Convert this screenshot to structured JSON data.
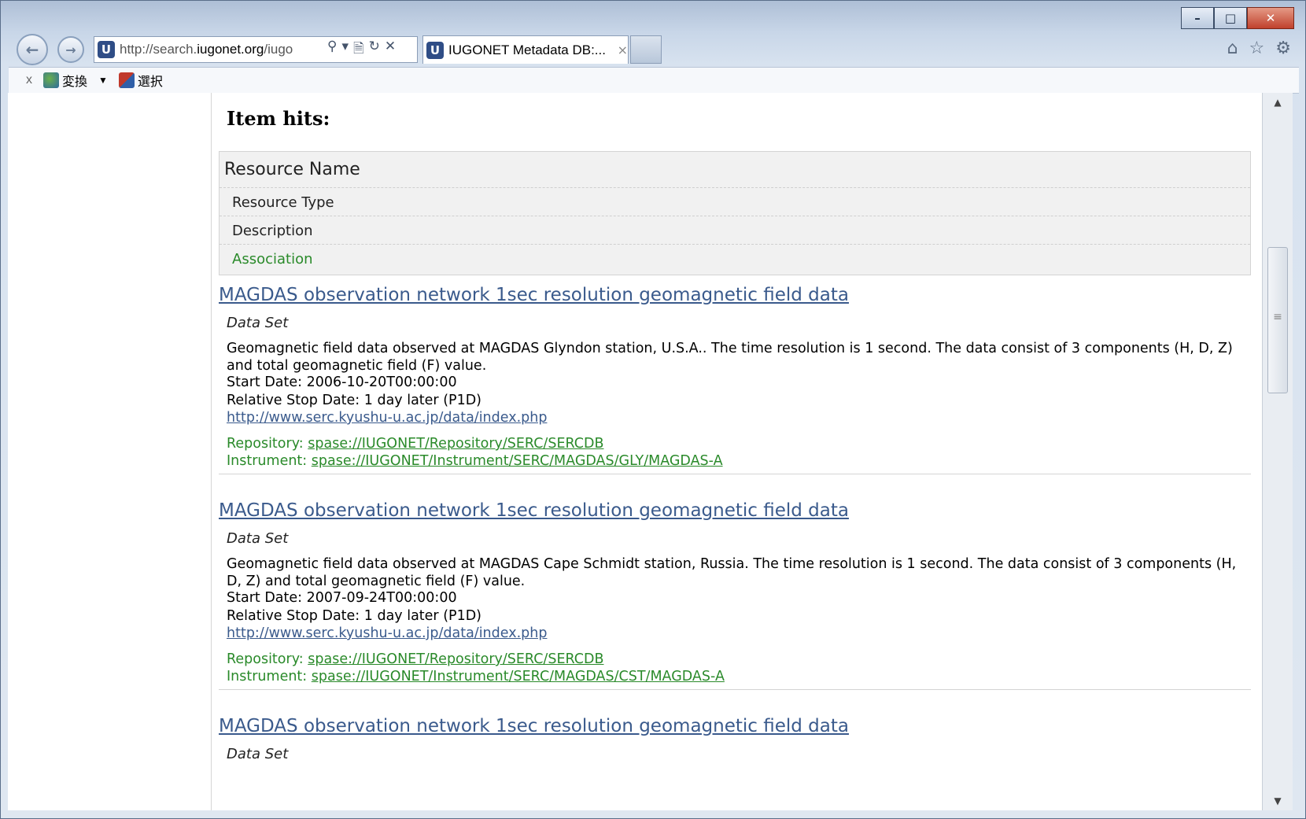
{
  "browser": {
    "url_prefix": "http://search.",
    "url_domain": "iugonet.org",
    "url_suffix": "/iugo",
    "tab_title": "IUGONET Metadata DB:...",
    "addr_tools": [
      "⚲",
      "▾",
      "🗎",
      "↻",
      "✕"
    ],
    "right_icons": [
      "⌂",
      "☆",
      "⚙"
    ]
  },
  "window_controls": {
    "minimize": "–",
    "maximize": "□",
    "close": "✕"
  },
  "command_bar": {
    "close_symbol": "x",
    "convert_label": "変換",
    "select_label": "選択"
  },
  "main": {
    "hits_title": "Item hits:",
    "legend": {
      "name": "Resource Name",
      "type": "Resource Type",
      "description": "Description",
      "association": "Association"
    },
    "results": [
      {
        "title": "MAGDAS observation network 1sec resolution geomagnetic field data",
        "type": "Data Set",
        "description": "Geomagnetic field data observed at MAGDAS Glyndon station, U.S.A.. The time resolution is 1 second. The data consist of 3 components (H, D, Z) and total geomagnetic field (F) value.",
        "start_date": "Start Date: 2006-10-20T00:00:00",
        "stop_date": "Relative Stop Date: 1 day later (P1D)",
        "url": "http://www.serc.kyushu-u.ac.jp/data/index.php",
        "repository_label": "Repository: ",
        "repository": "spase://IUGONET/Repository/SERC/SERCDB",
        "instrument_label": "Instrument: ",
        "instrument": "spase://IUGONET/Instrument/SERC/MAGDAS/GLY/MAGDAS-A"
      },
      {
        "title": "MAGDAS observation network 1sec resolution geomagnetic field data",
        "type": "Data Set",
        "description": "Geomagnetic field data observed at MAGDAS Cape Schmidt station, Russia. The time resolution is 1 second. The data consist of 3 components (H, D, Z) and total geomagnetic field (F) value.",
        "start_date": "Start Date: 2007-09-24T00:00:00",
        "stop_date": "Relative Stop Date: 1 day later (P1D)",
        "url": "http://www.serc.kyushu-u.ac.jp/data/index.php",
        "repository_label": "Repository: ",
        "repository": "spase://IUGONET/Repository/SERC/SERCDB",
        "instrument_label": "Instrument: ",
        "instrument": "spase://IUGONET/Instrument/SERC/MAGDAS/CST/MAGDAS-A"
      },
      {
        "title": "MAGDAS observation network 1sec resolution geomagnetic field data",
        "type": "Data Set"
      }
    ]
  },
  "scrollbar": {
    "up_arrow": "▲",
    "down_arrow": "▼",
    "grip": "≡"
  }
}
